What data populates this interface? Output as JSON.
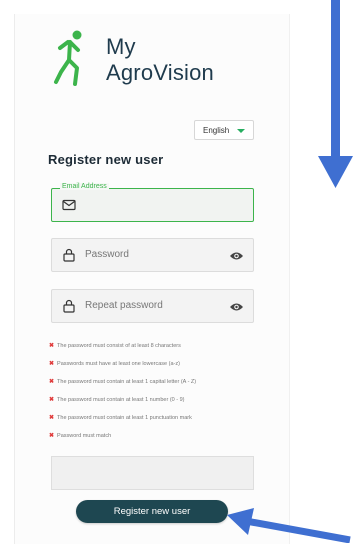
{
  "brand": {
    "line1": "My",
    "line2": "AgroVision"
  },
  "language": {
    "selected": "English"
  },
  "form": {
    "heading": "Register new user",
    "email": {
      "label": "Email Address",
      "value": ""
    },
    "password": {
      "placeholder": "Password"
    },
    "repeat_password": {
      "placeholder": "Repeat password"
    },
    "rules": [
      "The password must consist of at least 8 characters",
      "Passwords must have at least one lowercase (a-z)",
      "The password must contain at least 1 capital letter (A - Z)",
      "The password must contain at least 1 number (0 - 9)",
      "The password must contain at least 1 punctuation mark",
      "Password must match"
    ],
    "submit_label": "Register new user"
  },
  "colors": {
    "accent_green": "#3cb44b",
    "brand_dark": "#1f3b4d",
    "button_bg": "#1e4751",
    "error_red": "#e03b3b",
    "annotation_arrow": "#3f6fd1"
  },
  "icons": [
    "runner-logo-icon",
    "caret-down-icon",
    "mail-icon",
    "lock-icon",
    "eye-icon",
    "error-x-icon",
    "arrow-annotation"
  ]
}
